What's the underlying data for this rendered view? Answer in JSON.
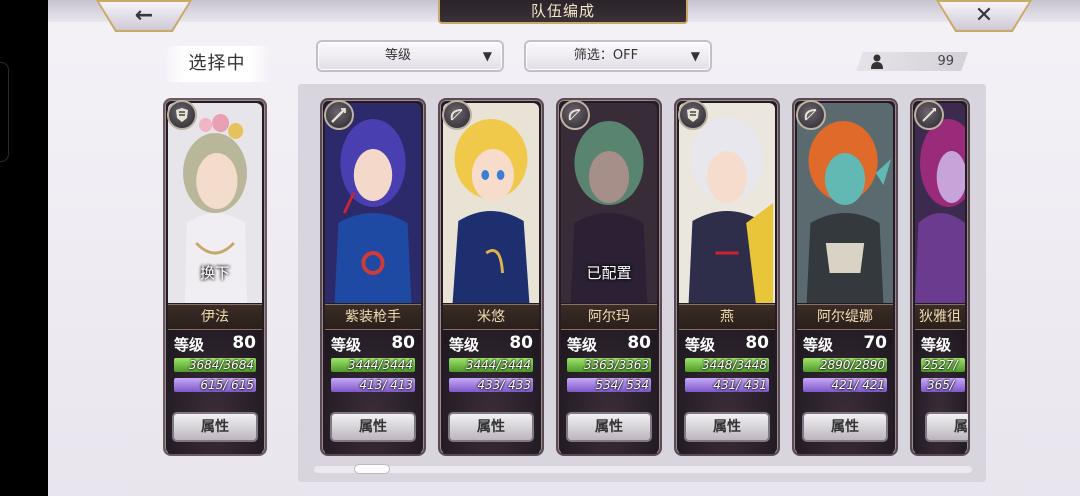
{
  "header": {
    "title": "队伍编成",
    "back_glyph": "←",
    "close_glyph": "✕"
  },
  "selection_label": "选择中",
  "sort_dropdown": {
    "value": "等级",
    "arrow": "▼"
  },
  "filter_dropdown": {
    "value": "筛选：OFF",
    "arrow": "▼"
  },
  "unit_count": {
    "icon": "person-icon",
    "value": "99"
  },
  "level_label": "等级",
  "attr_label": "属性",
  "selected_card": {
    "name": "伊法",
    "level": "80",
    "hp": "3684/3684",
    "mp": "615/ 615",
    "weapon_icon": "armor-icon",
    "overlay": "换下",
    "hp_fill": 1.0,
    "mp_fill": 1.0
  },
  "cards": [
    {
      "name": "紫装枪手",
      "level": "80",
      "hp": "3444/3444",
      "mp": "413/ 413",
      "weapon_icon": "gun-icon",
      "overlay": "",
      "hp_fill": 1.0,
      "mp_fill": 1.0
    },
    {
      "name": "米悠",
      "level": "80",
      "hp": "3444/3444",
      "mp": "433/ 433",
      "weapon_icon": "bow-icon",
      "overlay": "",
      "hp_fill": 1.0,
      "mp_fill": 1.0
    },
    {
      "name": "阿尔玛",
      "level": "80",
      "hp": "3363/3363",
      "mp": "534/ 534",
      "weapon_icon": "bow-icon",
      "overlay": "已配置",
      "hp_fill": 1.0,
      "mp_fill": 1.0
    },
    {
      "name": "燕",
      "level": "80",
      "hp": "3448/3448",
      "mp": "431/ 431",
      "weapon_icon": "armor-icon",
      "overlay": "",
      "hp_fill": 1.0,
      "mp_fill": 1.0
    },
    {
      "name": "阿尔缇娜",
      "level": "70",
      "hp": "2890/2890",
      "mp": "421/ 421",
      "weapon_icon": "bow-icon",
      "overlay": "",
      "hp_fill": 1.0,
      "mp_fill": 1.0
    },
    {
      "name": "狄雅徂",
      "level": "",
      "hp": "2527/",
      "mp": "365/",
      "weapon_icon": "spear-icon",
      "overlay": "",
      "hp_fill": 1.0,
      "mp_fill": 1.0
    }
  ],
  "colors": {
    "hp_bar": "#6cc143",
    "mp_bar": "#9b7ae0",
    "name_text": "#f0dcb0",
    "title_text": "#f3e6c8",
    "gold_trim": "#c9a966"
  }
}
